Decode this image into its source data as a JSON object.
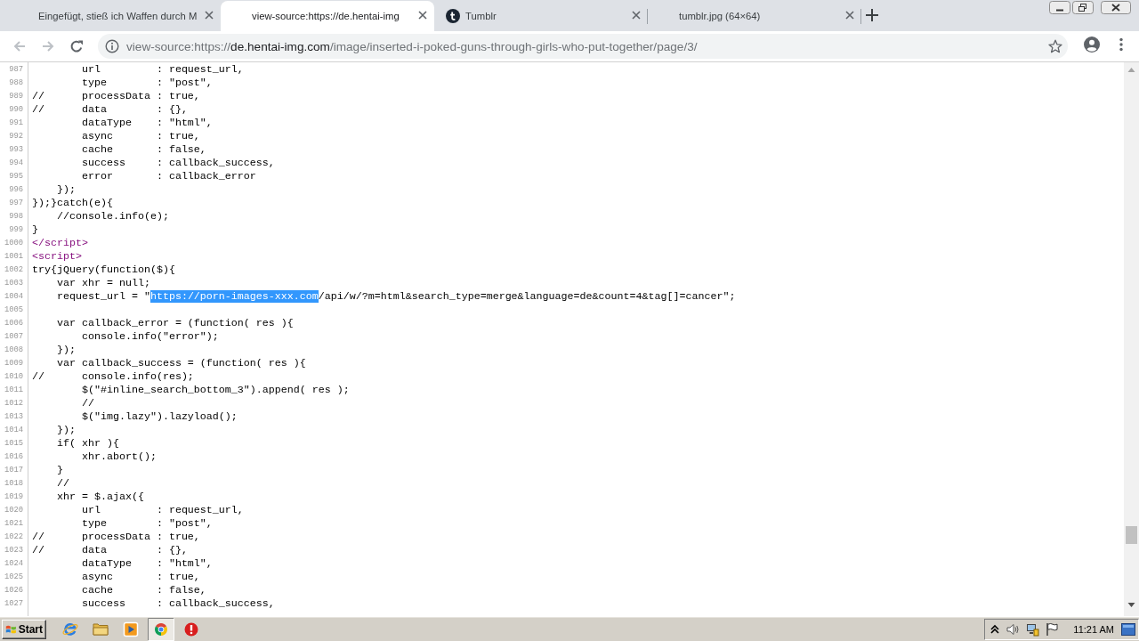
{
  "tabs": [
    {
      "title": "Eingefügt, stieß ich Waffen durch M",
      "selected": false,
      "favicon": false
    },
    {
      "title": "view-source:https://de.hentai-img",
      "selected": true,
      "favicon": false
    },
    {
      "title": "Tumblr",
      "selected": false,
      "favicon": true
    },
    {
      "title": "tumblr.jpg (64×64)",
      "selected": false,
      "favicon": false
    }
  ],
  "toolbar": {
    "back": {
      "disabled": true
    },
    "forward": {
      "disabled": true
    },
    "address": {
      "prefix": "view-source:https://",
      "host": "de.hentai-img.com",
      "path": "/image/inserted-i-poked-guns-through-girls-who-put-together/page/3/"
    }
  },
  "source": {
    "lines": [
      {
        "number": "987",
        "kind": "script",
        "text": "        url         : request_url,"
      },
      {
        "number": "988",
        "kind": "script",
        "text": "        type        : \"post\","
      },
      {
        "number": "989",
        "kind": "script",
        "text": "//      processData : true,"
      },
      {
        "number": "990",
        "kind": "script",
        "text": "//      data        : {},"
      },
      {
        "number": "991",
        "kind": "script",
        "text": "        dataType    : \"html\","
      },
      {
        "number": "992",
        "kind": "script",
        "text": "        async       : true,"
      },
      {
        "number": "993",
        "kind": "script",
        "text": "        cache       : false,"
      },
      {
        "number": "994",
        "kind": "script",
        "text": "        success     : callback_success,"
      },
      {
        "number": "995",
        "kind": "script",
        "text": "        error       : callback_error"
      },
      {
        "number": "996",
        "kind": "script",
        "text": "    });"
      },
      {
        "number": "997",
        "kind": "script",
        "text": "});}catch(e){"
      },
      {
        "number": "998",
        "kind": "script",
        "text": "    //console.info(e);"
      },
      {
        "number": "999",
        "kind": "script",
        "text": "}"
      },
      {
        "number": "1000",
        "kind": "tag",
        "text": "</script>"
      },
      {
        "number": "1001",
        "kind": "tag",
        "text": "<script>"
      },
      {
        "number": "1002",
        "kind": "script",
        "text": "try{jQuery(function($){"
      },
      {
        "number": "1003",
        "kind": "script",
        "text": "    var xhr = null;"
      },
      {
        "number": "1004",
        "kind": "script",
        "parts": [
          {
            "text": "    request_url = \"",
            "selected": false
          },
          {
            "text": "https://porn-images-xxx.com",
            "selected": true
          },
          {
            "text": "/api/w/?m=html&search_type=merge&language=de&count=4&tag[]=cancer\";",
            "selected": false
          }
        ]
      },
      {
        "number": "1005",
        "kind": "script"
      },
      {
        "number": "1006",
        "kind": "script",
        "text": "    var callback_error = (function( res ){"
      },
      {
        "number": "1007",
        "kind": "script",
        "text": "        console.info(\"error\");"
      },
      {
        "number": "1008",
        "kind": "script",
        "text": "    });"
      },
      {
        "number": "1009",
        "kind": "script",
        "text": "    var callback_success = (function( res ){"
      },
      {
        "number": "1010",
        "kind": "script",
        "text": "//      console.info(res);"
      },
      {
        "number": "1011",
        "kind": "script",
        "text": "        $(\"#inline_search_bottom_3\").append( res );"
      },
      {
        "number": "1012",
        "kind": "script",
        "text": "        //"
      },
      {
        "number": "1013",
        "kind": "script",
        "text": "        $(\"img.lazy\").lazyload();"
      },
      {
        "number": "1014",
        "kind": "script",
        "text": "    });"
      },
      {
        "number": "1015",
        "kind": "script",
        "text": "    if( xhr ){"
      },
      {
        "number": "1016",
        "kind": "script",
        "text": "        xhr.abort();"
      },
      {
        "number": "1017",
        "kind": "script",
        "text": "    }"
      },
      {
        "number": "1018",
        "kind": "script",
        "text": "    //"
      },
      {
        "number": "1019",
        "kind": "script",
        "text": "    xhr = $.ajax({"
      },
      {
        "number": "1020",
        "kind": "script",
        "text": "        url         : request_url,"
      },
      {
        "number": "1021",
        "kind": "script",
        "text": "        type        : \"post\","
      },
      {
        "number": "1022",
        "kind": "script",
        "text": "//      processData : true,"
      },
      {
        "number": "1023",
        "kind": "script",
        "text": "//      data        : {},"
      },
      {
        "number": "1024",
        "kind": "script",
        "text": "        dataType    : \"html\","
      },
      {
        "number": "1025",
        "kind": "script",
        "text": "        async       : true,"
      },
      {
        "number": "1026",
        "kind": "script",
        "text": "        cache       : false,"
      },
      {
        "number": "1027",
        "kind": "script",
        "text": "        success     : callback_success,"
      }
    ]
  },
  "taskbar": {
    "start": "Start",
    "apps": [
      {
        "kind": "ie",
        "selected": false
      },
      {
        "kind": "folder",
        "selected": false
      },
      {
        "kind": "player",
        "selected": false
      },
      {
        "kind": "browser",
        "selected": true
      },
      {
        "kind": "alert",
        "selected": false
      }
    ],
    "clock": "11:21 AM"
  }
}
